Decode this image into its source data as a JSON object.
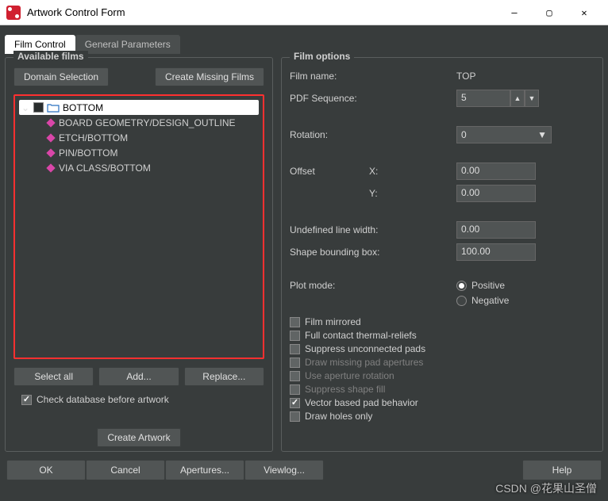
{
  "window": {
    "title": "Artwork Control Form"
  },
  "tabs": {
    "film": "Film Control",
    "general": "General Parameters"
  },
  "left": {
    "title": "Available films",
    "domain_btn": "Domain Selection",
    "missing_btn": "Create Missing Films",
    "tree": {
      "root": "BOTTOM",
      "items": [
        "BOARD GEOMETRY/DESIGN_OUTLINE",
        "ETCH/BOTTOM",
        "PIN/BOTTOM",
        "VIA CLASS/BOTTOM"
      ]
    },
    "select_all": "Select all",
    "add": "Add...",
    "replace": "Replace...",
    "check_db": "Check database before artwork",
    "create_artwork": "Create Artwork"
  },
  "right": {
    "title": "Film options",
    "film_name_label": "Film name:",
    "film_name": "TOP",
    "pdf_seq_label": "PDF Sequence:",
    "pdf_seq": "5",
    "rotation_label": "Rotation:",
    "rotation": "0",
    "offset_label": "Offset",
    "x_label": "X:",
    "y_label": "Y:",
    "x": "0.00",
    "y": "0.00",
    "ulw_label": "Undefined line width:",
    "ulw": "0.00",
    "sbb_label": "Shape bounding box:",
    "sbb": "100.00",
    "plot_label": "Plot mode:",
    "positive": "Positive",
    "negative": "Negative",
    "checks": {
      "mirrored": "Film mirrored",
      "thermal": "Full contact thermal-reliefs",
      "suppress_pads": "Suppress unconnected pads",
      "draw_missing": "Draw missing pad apertures",
      "aperture_rot": "Use aperture rotation",
      "shape_fill": "Suppress shape fill",
      "vector": "Vector based pad behavior",
      "holes": "Draw holes only"
    }
  },
  "bottom": {
    "ok": "OK",
    "cancel": "Cancel",
    "apertures": "Apertures...",
    "viewlog": "Viewlog...",
    "help": "Help"
  },
  "watermark": "CSDN @花果山圣僧"
}
